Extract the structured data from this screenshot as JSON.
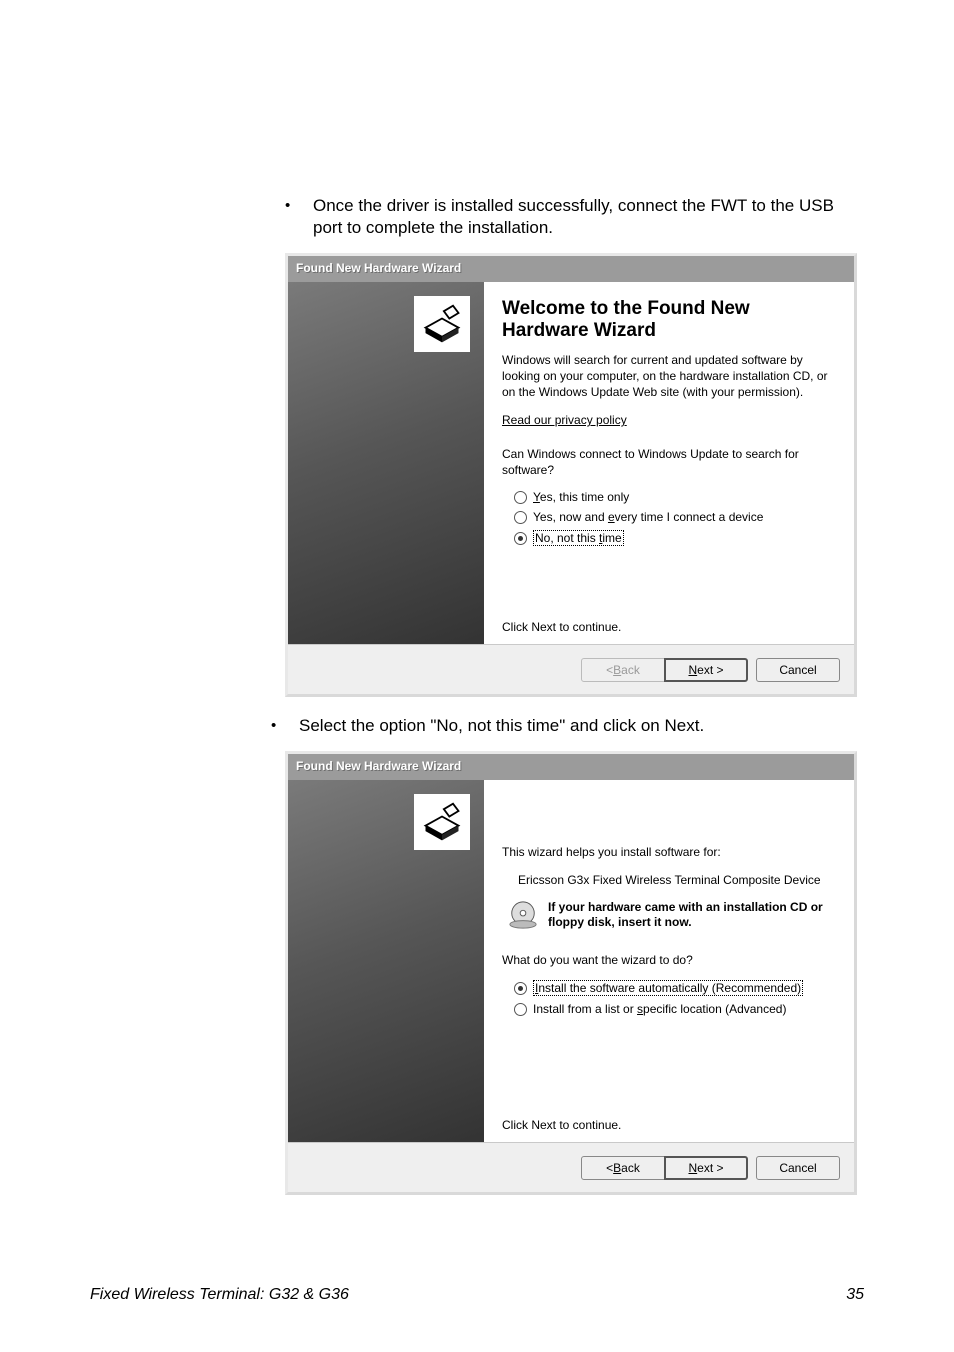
{
  "instructions": {
    "step1": "Once the driver is installed successfully, connect the FWT to the USB port to complete the installation.",
    "step2": "Select the option \"No, not this time\" and click on Next."
  },
  "wizard1": {
    "title": "Found New Hardware Wizard",
    "heading": "Welcome to the Found New Hardware Wizard",
    "intro": "Windows will search for current and updated software by looking on your computer, on the hardware installation CD, or on the Windows Update Web site (with your permission).",
    "privacy": "Read our privacy policy",
    "question": "Can Windows connect to Windows Update to search for software?",
    "options": {
      "opt1_pre": "",
      "opt1_u": "Y",
      "opt1_post": "es, this time only",
      "opt2_pre": "Yes, now and ",
      "opt2_u": "e",
      "opt2_post": "very time I connect a device",
      "opt3_pre": "No, not this ",
      "opt3_u": "t",
      "opt3_post": "ime"
    },
    "continue": "Click Next to continue.",
    "buttons": {
      "back_pre": "< ",
      "back_u": "B",
      "back_post": "ack",
      "next_u": "N",
      "next_post": "ext >",
      "cancel": "Cancel"
    }
  },
  "wizard2": {
    "title": "Found New Hardware Wizard",
    "helps": "This wizard helps you install software for:",
    "device": "Ericsson G3x Fixed Wireless Terminal Composite Device",
    "cd_hint": "If your hardware came with an installation CD or floppy disk, insert it now.",
    "question": "What do you want the wizard to do?",
    "options": {
      "opt1_u": "I",
      "opt1_post": "nstall the software automatically (Recommended)",
      "opt2_pre": "Install from a list or ",
      "opt2_u": "s",
      "opt2_post": "pecific location (Advanced)"
    },
    "continue": "Click Next to continue.",
    "buttons": {
      "back_pre": "< ",
      "back_u": "B",
      "back_post": "ack",
      "next_u": "N",
      "next_post": "ext >",
      "cancel": "Cancel"
    }
  },
  "footer": {
    "left": "Fixed Wireless Terminal: G32 & G36",
    "right": "35"
  }
}
